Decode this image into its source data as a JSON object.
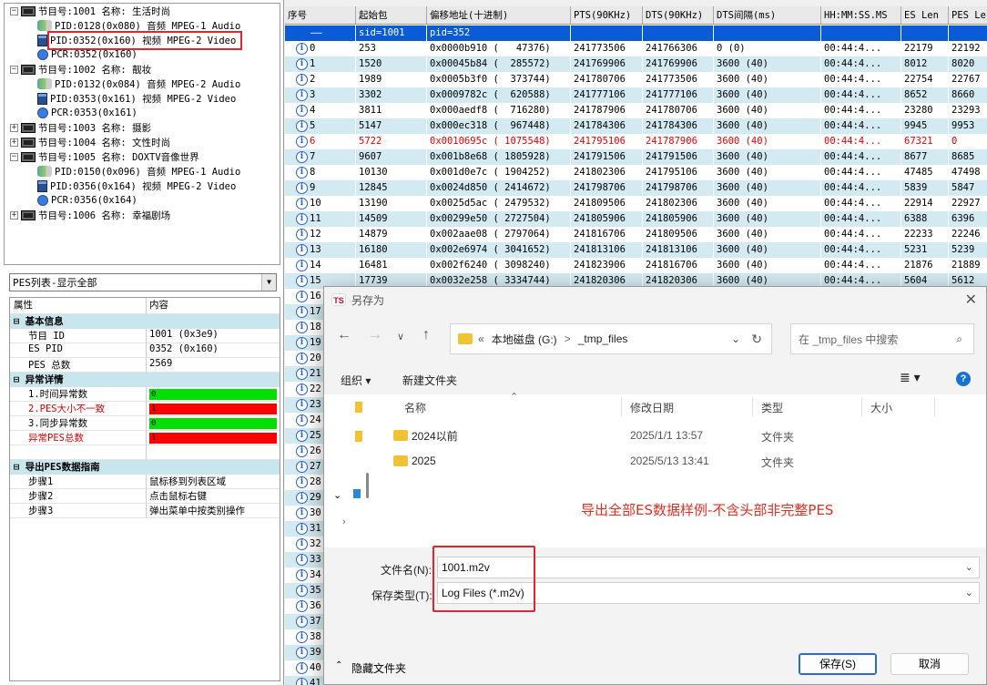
{
  "tree": [
    {
      "label": "节目号:1001 名称: 生活时尚",
      "type": "prog",
      "expanded": true,
      "indent": 0
    },
    {
      "label": "PID:0128(0x080) 音频 MPEG-1 Audio",
      "type": "audio",
      "indent": 1
    },
    {
      "label": "PID:0352(0x160) 视频 MPEG-2 Video",
      "type": "video",
      "indent": 1,
      "highlighted": true
    },
    {
      "label": "PCR:0352(0x160)",
      "type": "pcr",
      "indent": 1
    },
    {
      "label": "节目号:1002 名称: 靓妆",
      "type": "prog",
      "expanded": true,
      "indent": 0
    },
    {
      "label": "PID:0132(0x084) 音频 MPEG-2 Audio",
      "type": "audio",
      "indent": 1
    },
    {
      "label": "PID:0353(0x161) 视频 MPEG-2 Video",
      "type": "video",
      "indent": 1
    },
    {
      "label": "PCR:0353(0x161)",
      "type": "pcr",
      "indent": 1
    },
    {
      "label": "节目号:1003 名称: 摄影",
      "type": "prog",
      "expanded": false,
      "indent": 0
    },
    {
      "label": "节目号:1004 名称: 文性时尚",
      "type": "prog",
      "expanded": false,
      "indent": 0
    },
    {
      "label": "节目号:1005 名称: DOXTV音像世界",
      "type": "prog",
      "expanded": true,
      "indent": 0
    },
    {
      "label": "PID:0150(0x096) 音频 MPEG-1 Audio",
      "type": "audio",
      "indent": 1
    },
    {
      "label": "PID:0356(0x164) 视频 MPEG-2 Video",
      "type": "video",
      "indent": 1
    },
    {
      "label": "PCR:0356(0x164)",
      "type": "pcr",
      "indent": 1
    },
    {
      "label": "节目号:1006 名称: 幸福剧场",
      "type": "prog",
      "expanded": false,
      "indent": 0
    }
  ],
  "combo": {
    "value": "PES列表-显示全部"
  },
  "props": {
    "header": {
      "k": "属性",
      "v": "内容"
    },
    "rows": [
      {
        "k": "基本信息",
        "sec": true
      },
      {
        "k": "节目 ID",
        "v": "1001 (0x3e9)"
      },
      {
        "k": "ES PID",
        "v": "0352 (0x160)"
      },
      {
        "k": "PES 总数",
        "v": "2569"
      },
      {
        "k": "异常详情",
        "sec": true
      },
      {
        "k": "1.时间异常数",
        "v": "0",
        "bar": "green"
      },
      {
        "k": "2.PES大小不一致",
        "v": "1",
        "bar": "red",
        "red": true
      },
      {
        "k": "3.同步异常数",
        "v": "0",
        "bar": "green"
      },
      {
        "k": "异常PES总数",
        "v": "1",
        "bar": "red",
        "red": true
      },
      {
        "k": "",
        "v": ""
      },
      {
        "k": "导出PES数据指南",
        "sec": true
      },
      {
        "k": "步骤1",
        "v": "鼠标移到列表区域"
      },
      {
        "k": "步骤2",
        "v": "点击鼠标右键"
      },
      {
        "k": "步骤3",
        "v": "弹出菜单中按类别操作"
      }
    ]
  },
  "grid": {
    "columns": [
      "序号",
      "起始包",
      "偏移地址(十进制)",
      "PTS(90KHz)",
      "DTS(90KHz)",
      "DTS间隔(ms)",
      "HH:MM:SS.MS",
      "ES Len",
      "PES Le"
    ],
    "selected_row": {
      "c0": "——",
      "c1": "sid=1001",
      "c2": "pid=352"
    },
    "rows": [
      [
        "0",
        "253",
        "0x0000b910 (   47376)",
        "241773506",
        "241766306",
        "0 (0)",
        "00:44:4...",
        "22179",
        "22192"
      ],
      [
        "1",
        "1520",
        "0x00045b84 (  285572)",
        "241769906",
        "241769906",
        "3600 (40)",
        "00:44:4...",
        "8012",
        "8020"
      ],
      [
        "2",
        "1989",
        "0x0005b3f0 (  373744)",
        "241780706",
        "241773506",
        "3600 (40)",
        "00:44:4...",
        "22754",
        "22767"
      ],
      [
        "3",
        "3302",
        "0x0009782c (  620588)",
        "241777106",
        "241777106",
        "3600 (40)",
        "00:44:4...",
        "8652",
        "8660"
      ],
      [
        "4",
        "3811",
        "0x000aedf8 (  716280)",
        "241787906",
        "241780706",
        "3600 (40)",
        "00:44:4...",
        "23280",
        "23293"
      ],
      [
        "5",
        "5147",
        "0x000ec318 (  967448)",
        "241784306",
        "241784306",
        "3600 (40)",
        "00:44:4...",
        "9945",
        "9953"
      ],
      [
        "6",
        "5722",
        "0x0010695c ( 1075548)",
        "241795106",
        "241787906",
        "3600 (40)",
        "00:44:4...",
        "67321",
        "0"
      ],
      [
        "7",
        "9607",
        "0x001b8e68 ( 1805928)",
        "241791506",
        "241791506",
        "3600 (40)",
        "00:44:4...",
        "8677",
        "8685"
      ],
      [
        "8",
        "10130",
        "0x001d0e7c ( 1904252)",
        "241802306",
        "241795106",
        "3600 (40)",
        "00:44:4...",
        "47485",
        "47498"
      ],
      [
        "9",
        "12845",
        "0x0024d850 ( 2414672)",
        "241798706",
        "241798706",
        "3600 (40)",
        "00:44:4...",
        "5839",
        "5847"
      ],
      [
        "10",
        "13190",
        "0x0025d5ac ( 2479532)",
        "241809506",
        "241802306",
        "3600 (40)",
        "00:44:4...",
        "22914",
        "22927"
      ],
      [
        "11",
        "14509",
        "0x00299e50 ( 2727504)",
        "241805906",
        "241805906",
        "3600 (40)",
        "00:44:4...",
        "6388",
        "6396"
      ],
      [
        "12",
        "14879",
        "0x002aae08 ( 2797064)",
        "241816706",
        "241809506",
        "3600 (40)",
        "00:44:4...",
        "22233",
        "22246"
      ],
      [
        "13",
        "16180",
        "0x002e6974 ( 3041652)",
        "241813106",
        "241813106",
        "3600 (40)",
        "00:44:4...",
        "5231",
        "5239"
      ],
      [
        "14",
        "16481",
        "0x002f6240 ( 3098240)",
        "241823906",
        "241816706",
        "3600 (40)",
        "00:44:4...",
        "21876",
        "21889"
      ],
      [
        "15",
        "17739",
        "0x0032e258 ( 3334744)",
        "241820306",
        "241820306",
        "3600 (40)",
        "00:44:4...",
        "5604",
        "5612"
      ]
    ],
    "error_row": 6,
    "more_rows": [
      "16",
      "17",
      "18",
      "19",
      "20",
      "21",
      "22",
      "23",
      "24",
      "25",
      "26",
      "27",
      "28",
      "29",
      "30",
      "31",
      "32",
      "33",
      "34",
      "35",
      "36",
      "37",
      "38",
      "39",
      "40",
      "41"
    ]
  },
  "dialog": {
    "title": "另存为",
    "path": [
      "本地磁盘 (G:)",
      "_tmp_files"
    ],
    "path_prefix": "«",
    "path_sep": ">",
    "search_placeholder": "在 _tmp_files 中搜索",
    "organize": "组织 ▾",
    "new_folder": "新建文件夹",
    "col_name": "名称",
    "col_date": "修改日期",
    "col_type": "类型",
    "col_size": "大小",
    "files": [
      {
        "name": "2024以前",
        "date": "2025/1/1 13:57",
        "type": "文件夹"
      },
      {
        "name": "2025",
        "date": "2025/5/13 13:41",
        "type": "文件夹"
      }
    ],
    "annotation": "导出全部ES数据样例-不含头部非完整PES",
    "filename_label": "文件名(N):",
    "filename": "1001.m2v",
    "filetype_label": "保存类型(T):",
    "filetype": "Log Files (*.m2v)",
    "hide_folders": "隐藏文件夹",
    "save": "保存(S)",
    "cancel": "取消"
  }
}
